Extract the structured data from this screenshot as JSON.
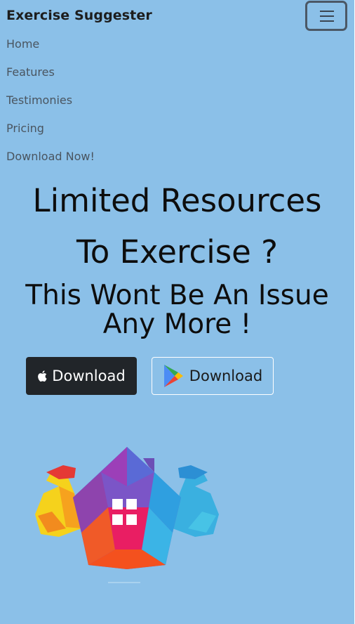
{
  "navbar": {
    "brand": "Exercise Suggester",
    "toggler_icon": "hamburger-icon",
    "links": [
      "Home",
      "Features",
      "Testimonies",
      "Pricing",
      "Download Now!"
    ]
  },
  "hero": {
    "line1": "Limited Resources",
    "line2": "To Exercise ?",
    "line3": "This Wont Be An Issue",
    "line4": "Any More !"
  },
  "buttons": {
    "apple_label": "Download",
    "apple_icon": "apple-icon",
    "google_label": "Download",
    "google_icon": "google-play-icon"
  },
  "image": {
    "icon": "muscular-house-mascot"
  },
  "colors": {
    "background": "#8bc0e8",
    "dark_button": "#212529"
  }
}
